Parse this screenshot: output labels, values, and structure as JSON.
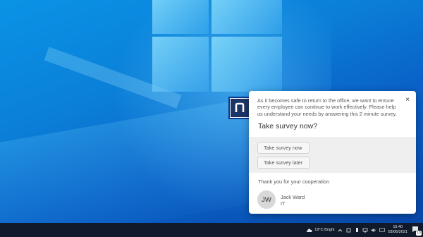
{
  "survey": {
    "intro": "As it becomes safe to return to the office, we want to ensure every employee can continue to work effectively. Please help us understand your needs by answering this 2 minute survey.",
    "close_symbol": "×",
    "question": "Take survey now?",
    "options": [
      {
        "label": "Take survey now"
      },
      {
        "label": "Take survey later"
      }
    ],
    "thanks": "Thank you for your cooperation",
    "sender": {
      "initials": "JW",
      "name": "Jack Ward",
      "department": "IT"
    }
  },
  "taskbar": {
    "weather_text": "19°C Bright",
    "time": "15:40",
    "date": "03/06/2021",
    "notification_count": "13",
    "icons": [
      "weather-icon",
      "chevron-up-icon",
      "network-icon",
      "battery-icon",
      "sound-icon",
      "language-icon",
      "notification-icon"
    ]
  },
  "colors": {
    "desktop_top": "#0a93e6",
    "desktop_bottom": "#0845a6",
    "taskbar": "#101a2a",
    "logo_bg": "#1b3566"
  }
}
